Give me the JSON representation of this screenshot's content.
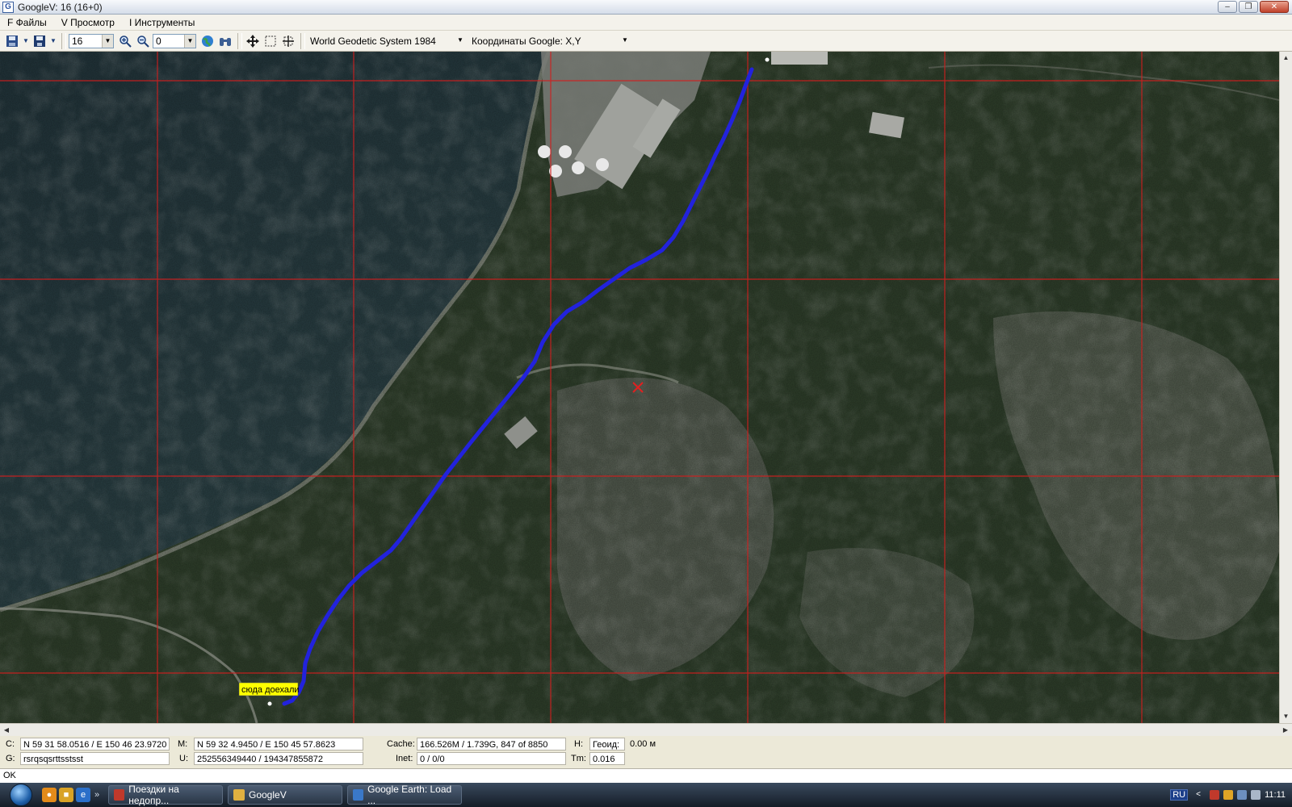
{
  "window": {
    "title": "GoogleV: 16 (16+0)",
    "app_icon_letter": "G",
    "controls": {
      "minimize": "–",
      "maximize": "❐",
      "close": "✕"
    }
  },
  "menu": {
    "items": [
      {
        "label": "F Файлы"
      },
      {
        "label": "V Просмотр"
      },
      {
        "label": "I Инструменты"
      }
    ]
  },
  "toolbar": {
    "zoom_level": "16",
    "layer_value": "0",
    "datum": "World Geodetic System 1984",
    "coord_mode": "Координаты Google: X,Y"
  },
  "map": {
    "annotation": "сюда доехали",
    "track_color": "#2222dd",
    "grid_color": "#d21e1e"
  },
  "status": {
    "c_label": "C:",
    "c_value": "N  59 31 58.0516 / E 150 46 23.9720",
    "m_label": "M:",
    "m_value": "N  59 32 4.9450 / E 150 45 57.8623",
    "cache_label": "Cache:",
    "cache_value": "166.526M / 1.739G, 847 of 8850",
    "h_label": "H:",
    "geoid_label": "Геоид:",
    "geoid_value": "0.00 м",
    "g_label": "G:",
    "g_value": "rsrqsqsrttsstsst",
    "u_label": "U:",
    "u_value": "252556349440 / 194347855872",
    "inet_label": "Inet:",
    "inet_value": "0 / 0/0",
    "tm_label": "Tm:",
    "tm_value": "0.016",
    "ok_text": "OK"
  },
  "taskbar": {
    "tasks": [
      {
        "label": "Поездки на недопр...",
        "icon_color": "#c0392b"
      },
      {
        "label": "GoogleV",
        "icon_color": "#e0b040"
      },
      {
        "label": "Google Earth: Load ...",
        "icon_color": "#3a78c8"
      }
    ],
    "language": "RU",
    "clock": "11:11"
  }
}
